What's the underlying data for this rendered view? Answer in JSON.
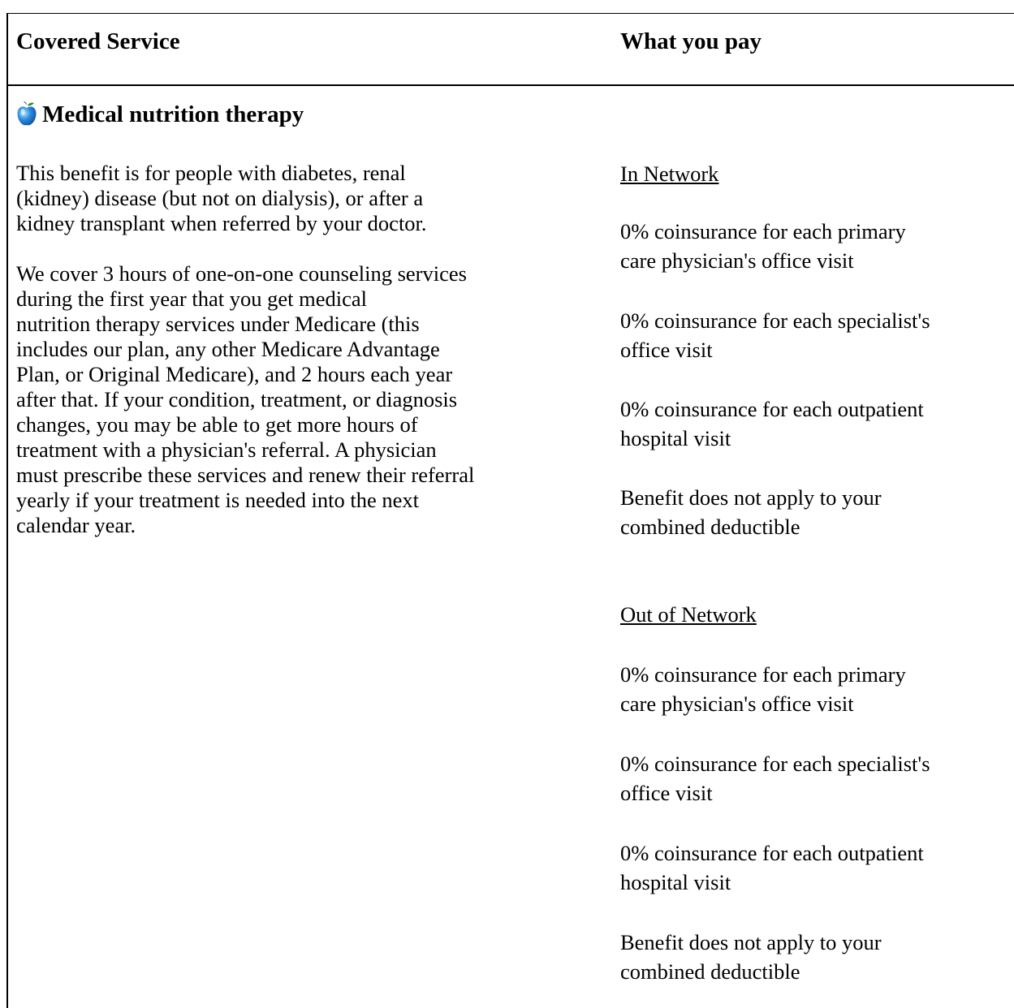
{
  "header": {
    "covered_service": "Covered Service",
    "what_you_pay": "What you pay"
  },
  "service": {
    "icon": "apple-icon",
    "title": "Medical nutrition therapy",
    "description": [
      "This benefit is for people with diabetes, renal\n(kidney) disease (but not on dialysis), or after a\nkidney transplant when referred by your doctor.",
      "We cover 3 hours of one-on-one counseling services\nduring the first year that you get medical\nnutrition therapy services under Medicare (this\nincludes our plan, any other Medicare Advantage\nPlan, or Original Medicare), and 2 hours each year\nafter that.  If your condition, treatment, or diagnosis\nchanges, you may be able to get more hours of\ntreatment with a physician's referral.  A physician\nmust prescribe these services and renew their referral\nyearly if your treatment is needed into the next\ncalendar year."
    ]
  },
  "in_network": {
    "title": "In Network",
    "items": [
      "0% coinsurance for each primary\ncare physician's office visit",
      "0% coinsurance for each specialist's\noffice visit",
      "0% coinsurance for each outpatient\nhospital visit",
      "Benefit does not apply to your\ncombined deductible"
    ]
  },
  "out_of_network": {
    "title": "Out of Network",
    "items": [
      "0% coinsurance for each primary\ncare physician's office visit",
      "0% coinsurance for each specialist's\noffice visit",
      "0% coinsurance for each outpatient\nhospital visit",
      "Benefit does not apply to your\ncombined deductible"
    ]
  }
}
